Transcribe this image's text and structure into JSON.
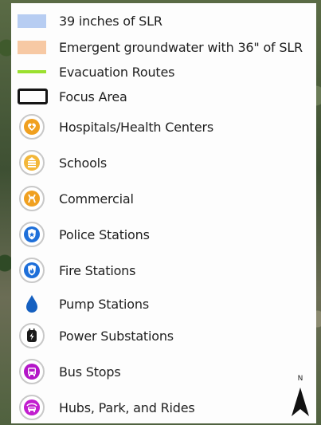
{
  "legend": {
    "items": [
      {
        "label": "39 inches of SLR",
        "symbol": "fill-swatch",
        "color": "#b7cdf2"
      },
      {
        "label": "Emergent groundwater with 36\" of SLR",
        "symbol": "fill-swatch",
        "color": "#f7c9a4"
      },
      {
        "label": "Evacuation Routes",
        "symbol": "line",
        "color": "#9be02f"
      },
      {
        "label": "Focus Area",
        "symbol": "outline-box",
        "color": "#151515"
      },
      {
        "label": "Hospitals/Health Centers",
        "symbol": "hospital-icon",
        "color": "#f0a020"
      },
      {
        "label": "Schools",
        "symbol": "school-icon",
        "color": "#f0b030"
      },
      {
        "label": "Commercial",
        "symbol": "commercial-icon",
        "color": "#f0a020"
      },
      {
        "label": "Police Stations",
        "symbol": "police-icon",
        "color": "#1e6fd9"
      },
      {
        "label": "Fire Stations",
        "symbol": "fire-icon",
        "color": "#1e6fd9"
      },
      {
        "label": "Pump Stations",
        "symbol": "pump-icon",
        "color": "#1560c0"
      },
      {
        "label": "Power Substations",
        "symbol": "power-icon",
        "color": "#1a1a1a"
      },
      {
        "label": "Bus Stops",
        "symbol": "bus-icon",
        "color": "#b417c8"
      },
      {
        "label": "Hubs, Park, and Rides",
        "symbol": "park-ride-icon",
        "color": "#c21fcf"
      }
    ]
  },
  "north_arrow": {
    "letter": "N"
  }
}
